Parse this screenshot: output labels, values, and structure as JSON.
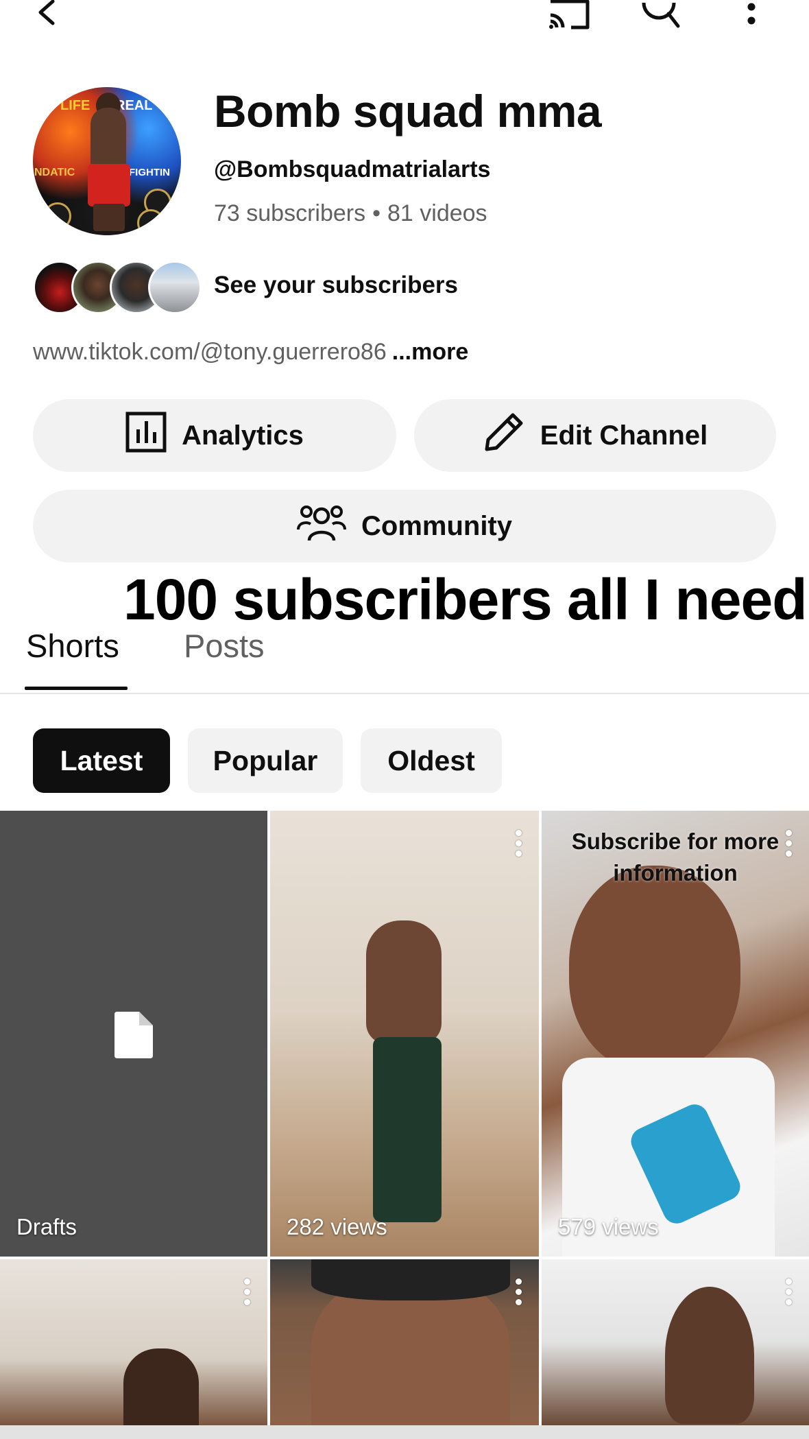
{
  "topbar": {
    "back_icon": "chevron-left-icon",
    "cast_icon": "cast-icon",
    "search_icon": "search-icon",
    "more_icon": "more-vertical-icon"
  },
  "channel": {
    "title": "Bomb squad mma",
    "handle": "@Bombsquadmatrialarts",
    "subscribers": "73 subscribers",
    "separator": "•",
    "videos": "81 videos",
    "avatar_text_left": "LIFE",
    "avatar_text_right": "REAL",
    "avatar_text_mid_left": "NDATIC",
    "avatar_text_mid_right": "FIGHTIN"
  },
  "subscribers_row": {
    "label": "See your subscribers"
  },
  "link": {
    "url": "www.tiktok.com/@tony.guerrero86",
    "more": "...more"
  },
  "buttons": {
    "analytics": "Analytics",
    "edit_channel": "Edit Channel",
    "community": "Community"
  },
  "overlay_text": "100 subscribers all I need",
  "tabs": [
    {
      "label": "Shorts",
      "active": true
    },
    {
      "label": "Posts",
      "active": false
    }
  ],
  "chips": [
    {
      "label": "Latest",
      "selected": true
    },
    {
      "label": "Popular",
      "selected": false
    },
    {
      "label": "Oldest",
      "selected": false
    }
  ],
  "grid": [
    {
      "label": "Drafts"
    },
    {
      "label": "282 views"
    },
    {
      "label": "579 views",
      "caption": "Subscribe for more information"
    },
    {
      "label": ""
    },
    {
      "label": ""
    },
    {
      "label": ""
    }
  ],
  "colors": {
    "accent_dark": "#0f0f0f",
    "secondary_text": "#606060",
    "button_bg": "#f2f2f2"
  }
}
